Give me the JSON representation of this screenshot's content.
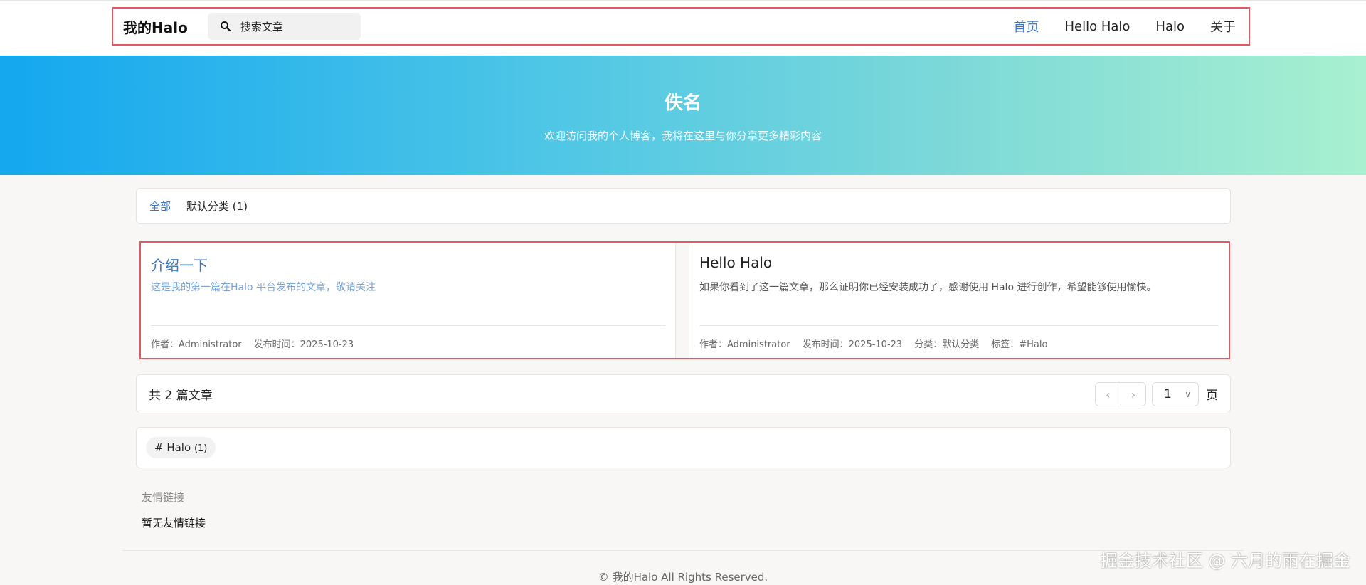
{
  "header": {
    "site_title": "我的Halo",
    "search_placeholder": "搜索文章",
    "nav": [
      {
        "label": "首页",
        "active": true
      },
      {
        "label": "Hello Halo",
        "active": false
      },
      {
        "label": "Halo",
        "active": false
      },
      {
        "label": "关于",
        "active": false
      }
    ]
  },
  "hero": {
    "title": "佚名",
    "subtitle": "欢迎访问我的个人博客，我将在这里与你分享更多精彩内容"
  },
  "categories": [
    {
      "label": "全部",
      "active": true
    },
    {
      "label": "默认分类 (1)",
      "active": false
    }
  ],
  "posts": [
    {
      "title": "介绍一下",
      "excerpt": "这是我的第一篇在Halo 平台发布的文章，敬请关注",
      "author": "作者：Administrator",
      "date": "发布时间：2025-10-23"
    },
    {
      "title": "Hello Halo",
      "excerpt": "如果你看到了这一篇文章，那么证明你已经安装成功了，感谢使用 Halo 进行创作，希望能够使用愉快。",
      "author": "作者：Administrator",
      "date": "发布时间：2025-10-23",
      "category": "分类：默认分类",
      "tag": "标签：#Halo"
    }
  ],
  "pager": {
    "total": "共 2 篇文章",
    "prev": "‹",
    "next": "›",
    "current_page": "1",
    "unit": "页"
  },
  "tags": [
    {
      "label": "# Halo",
      "count": "(1)"
    }
  ],
  "links": {
    "title": "友情链接",
    "empty": "暂无友情链接"
  },
  "footer": {
    "text": "© 我的Halo All Rights Reserved."
  },
  "watermark": "掘金技术社区 @ 六月的雨在掘金",
  "colors": {
    "accent": "#3b76c4",
    "highlight_border": "#e05a5f"
  }
}
